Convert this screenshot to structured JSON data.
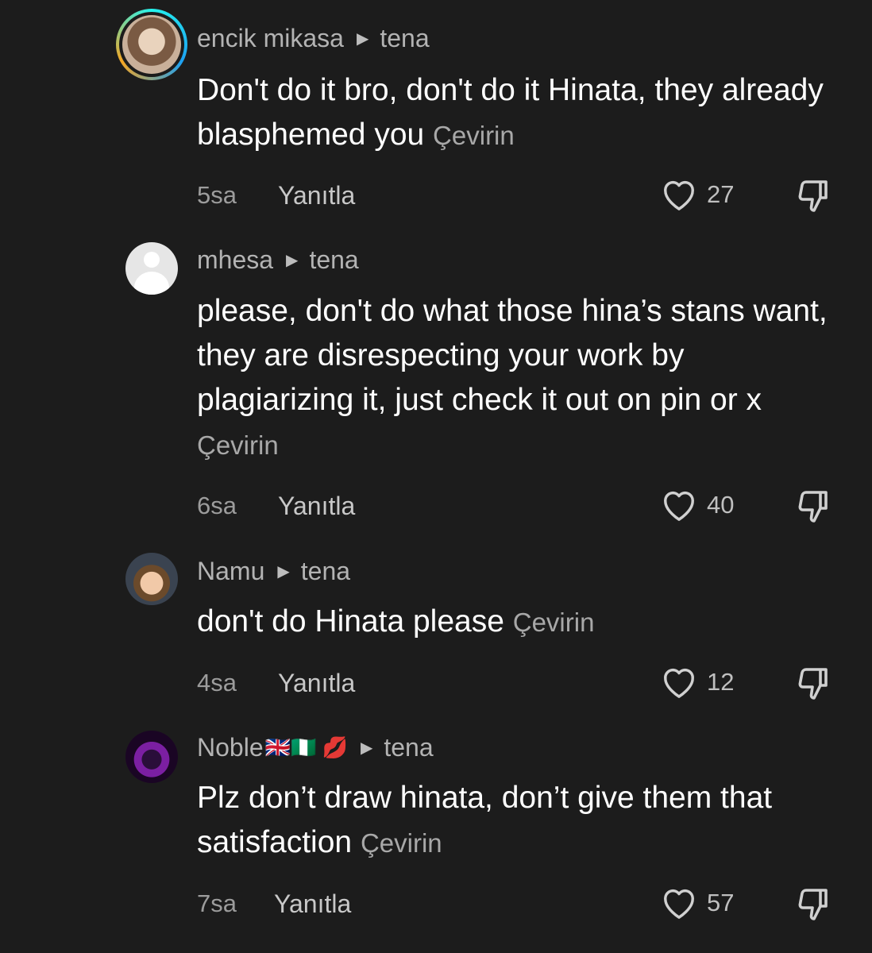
{
  "comments": [
    {
      "username": "encik mikasa",
      "reply_to": "tena",
      "text": "Don't do it bro, don't do it Hinata, they already blasphemed you",
      "translate": "Çevirin",
      "time": "5sa",
      "reply_label": "Yanıtla",
      "likes": "27"
    },
    {
      "username": "mhesa",
      "reply_to": "tena",
      "text": "please, don't do what those hina’s stans want, they are disrespecting your work by plagiarizing it, just check it out on pin or x",
      "translate": "Çevirin",
      "time": "6sa",
      "reply_label": "Yanıtla",
      "likes": "40"
    },
    {
      "username": "Namu",
      "reply_to": "tena",
      "text": "don't do Hinata please",
      "translate": "Çevirin",
      "time": "4sa",
      "reply_label": "Yanıtla",
      "likes": "12"
    },
    {
      "username": "Noble",
      "username_flags": "🇬🇧🇳🇬 💋",
      "reply_to": "tena",
      "text": "Plz don’t draw hinata, don’t give them that satisfaction",
      "translate": "Çevirin",
      "time": "7sa",
      "reply_label": "Yanıtla",
      "likes": "57"
    }
  ],
  "icons": {
    "heart": "heart-outline-icon",
    "dislike": "thumbs-down-icon",
    "arrow": "reply-arrow-icon"
  },
  "colors": {
    "background": "#1c1c1c",
    "text": "#ffffff",
    "muted": "#a8a8a8"
  }
}
